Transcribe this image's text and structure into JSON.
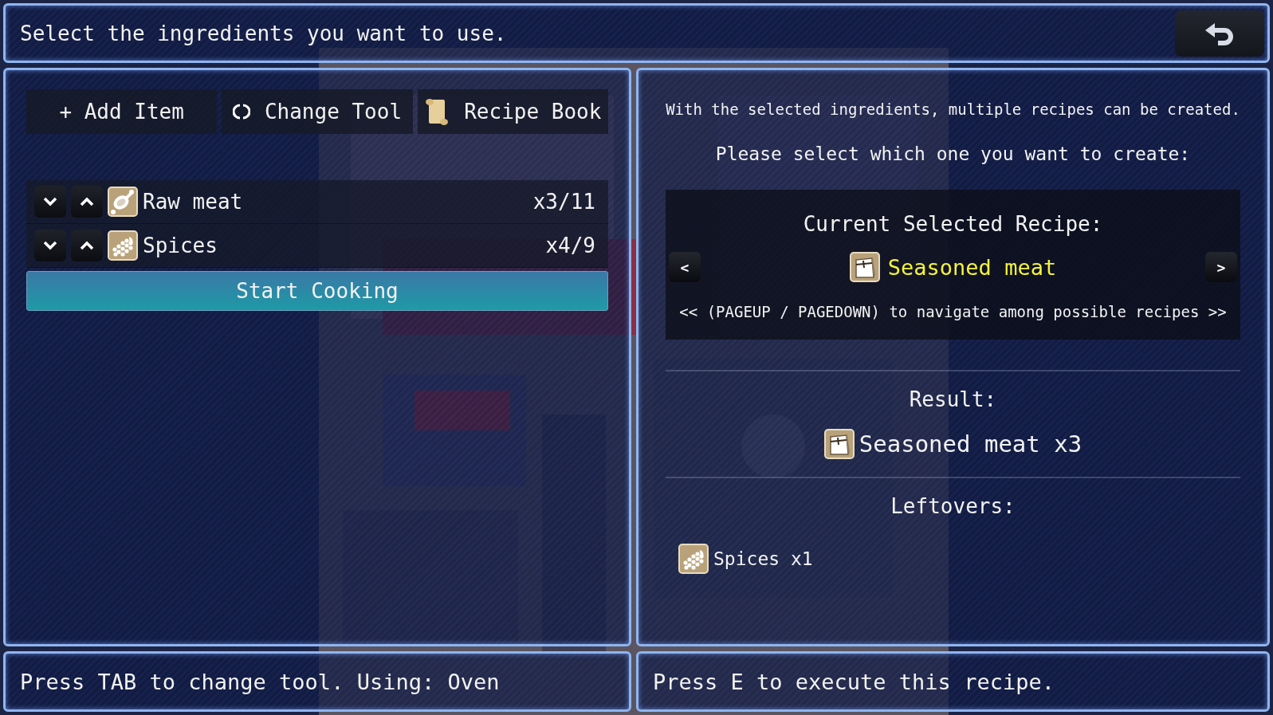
{
  "header": {
    "title": "Select the ingredients you want to use."
  },
  "toolbar": [
    {
      "label": "+ Add Item",
      "kind": "plain"
    },
    {
      "label": "Change Tool",
      "kind": "cycle"
    },
    {
      "label": "Recipe Book",
      "kind": "book"
    }
  ],
  "ingredients": [
    {
      "name": "Raw meat",
      "count": "x3/11",
      "kind": "meat"
    },
    {
      "name": "Spices",
      "count": "x4/9",
      "kind": "spices"
    }
  ],
  "start_button": "Start Cooking",
  "info": [
    "With the selected ingredients, multiple recipes can be created.",
    "Please select which one you want to create:"
  ],
  "recipe_selector": {
    "heading": "Current Selected Recipe:",
    "prev": "<",
    "next": ">",
    "name": "Seasoned meat",
    "kind": "seasoned",
    "hint": "<< (PAGEUP / PAGEDOWN) to navigate among possible recipes >>"
  },
  "result": {
    "heading": "Result:",
    "items": [
      {
        "label": "Seasoned meat x3",
        "kind": "seasoned"
      }
    ]
  },
  "leftovers": {
    "heading": "Leftovers:",
    "items": [
      {
        "label": "Spices x1",
        "kind": "spices"
      }
    ]
  },
  "status_left": "Press TAB to change tool. Using: Oven",
  "status_right": "Press E to execute this recipe."
}
